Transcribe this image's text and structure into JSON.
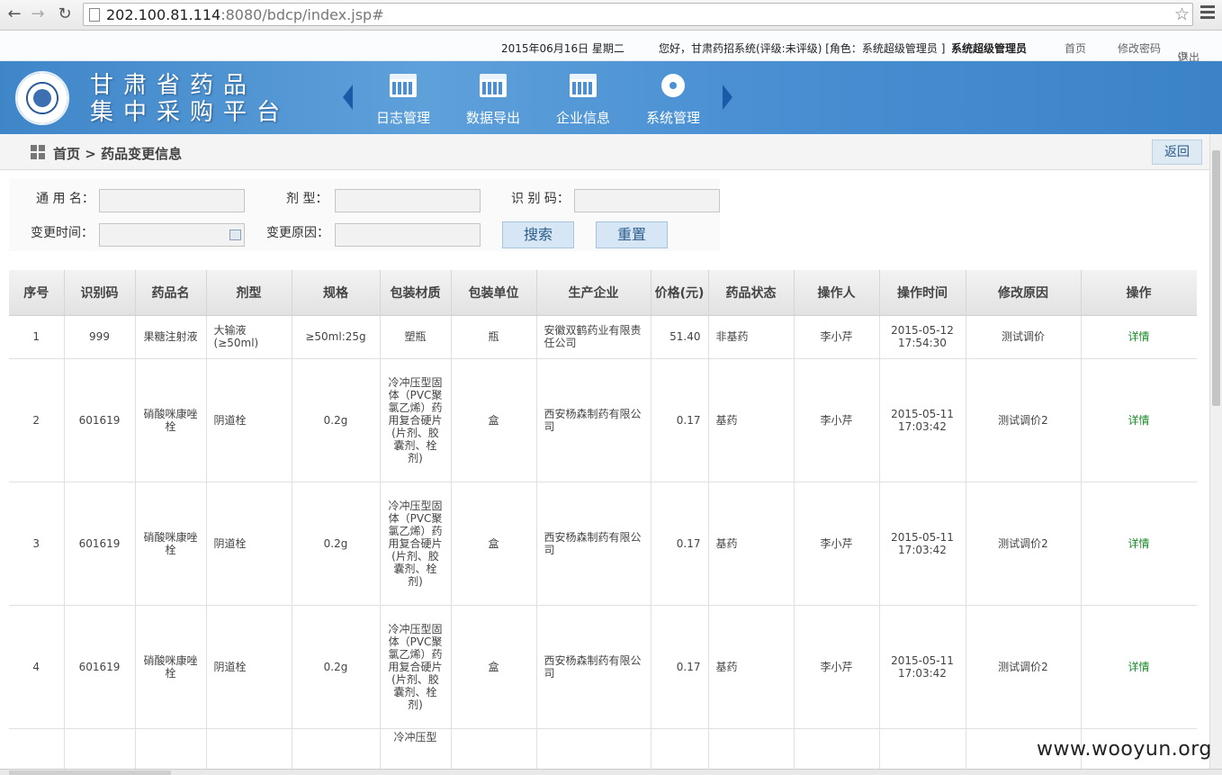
{
  "browser": {
    "url_host": "202.100.81.114",
    "url_rest": ":8080/bdcp/index.jsp#"
  },
  "infobar": {
    "date": "2015年06月16日 星期二",
    "greeting": "您好，甘肃药招系统(评级:未评级) [角色：系统超级管理员 ]",
    "username": "系统超级管理员",
    "home": "首页",
    "change_password": "修改密码",
    "logout": "退出"
  },
  "header": {
    "title_line1": "甘肃省药品",
    "title_line2": "集中采购平台",
    "nav": [
      {
        "label": "日志管理",
        "icon": "calendar-icon"
      },
      {
        "label": "数据导出",
        "icon": "calendar-icon"
      },
      {
        "label": "企业信息",
        "icon": "calendar-icon"
      },
      {
        "label": "系统管理",
        "icon": "gear-icon"
      }
    ]
  },
  "breadcrumb": {
    "home": "首页",
    "sep": ">",
    "current": "药品变更信息",
    "back": "返回"
  },
  "form": {
    "generic_name_label": "通 用 名：",
    "dosage_label": "剂    型：",
    "code_label": "识 别 码：",
    "change_time_label": "变更时间：",
    "change_reason_label": "变更原因：",
    "search": "搜索",
    "reset": "重置"
  },
  "table": {
    "headers": [
      "序号",
      "识别码",
      "药品名",
      "剂型",
      "规格",
      "包装材质",
      "包装单位",
      "生产企业",
      "价格(元)",
      "药品状态",
      "操作人",
      "操作时间",
      "修改原因",
      "操作"
    ],
    "rows": [
      [
        "1",
        "999",
        "果糖注射液",
        "大输液(≥50ml)",
        "≥50ml:25g",
        "塑瓶",
        "瓶",
        "安徽双鹤药业有限责任公司",
        "51.40",
        "非基药",
        "李小芹",
        "2015-05-12 17:54:30",
        "测试调价",
        "详情"
      ],
      [
        "2",
        "601619",
        "硝酸咪康唑栓",
        "阴道栓",
        "0.2g",
        "冷冲压型固体（PVC聚氯乙烯）药用复合硬片(片剂、胶囊剂、栓剂)",
        "盒",
        "西安杨森制药有限公司",
        "0.17",
        "基药",
        "李小芹",
        "2015-05-11 17:03:42",
        "测试调价2",
        "详情"
      ],
      [
        "3",
        "601619",
        "硝酸咪康唑栓",
        "阴道栓",
        "0.2g",
        "冷冲压型固体（PVC聚氯乙烯）药用复合硬片(片剂、胶囊剂、栓剂)",
        "盒",
        "西安杨森制药有限公司",
        "0.17",
        "基药",
        "李小芹",
        "2015-05-11 17:03:42",
        "测试调价2",
        "详情"
      ],
      [
        "4",
        "601619",
        "硝酸咪康唑栓",
        "阴道栓",
        "0.2g",
        "冷冲压型固体（PVC聚氯乙烯）药用复合硬片(片剂、胶囊剂、栓剂)",
        "盒",
        "西安杨森制药有限公司",
        "0.17",
        "基药",
        "李小芹",
        "2015-05-11 17:03:42",
        "测试调价2",
        "详情"
      ]
    ],
    "partial_row_text": "冷冲压型"
  },
  "watermark": "www.wooyun.org"
}
